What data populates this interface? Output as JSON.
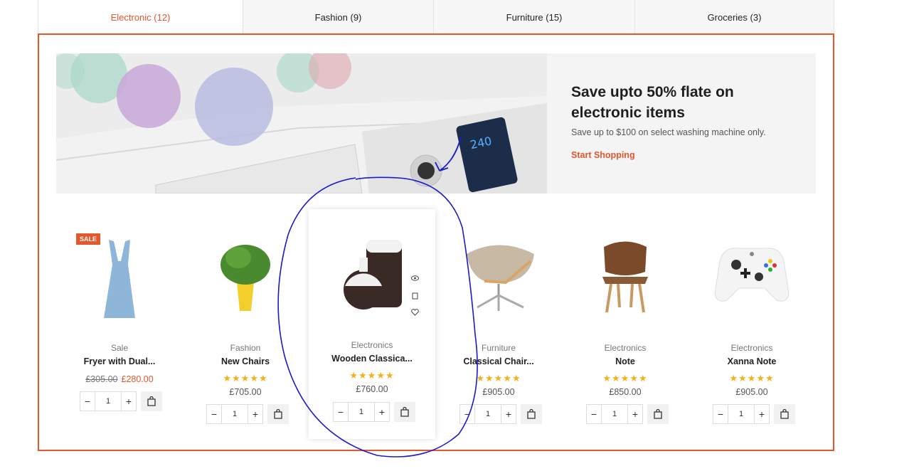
{
  "tabs": [
    {
      "label": "Electronic (12)"
    },
    {
      "label": "Fashion (9)"
    },
    {
      "label": "Furniture (15)"
    },
    {
      "label": "Groceries (3)"
    }
  ],
  "banner": {
    "title": "Save upto 50% flate on electronic items",
    "subtitle": "Save up to $100 on select washing machine only.",
    "cta": "Start Shopping"
  },
  "products": [
    {
      "badge": "SALE",
      "category": "Sale",
      "name": "Fryer with Dual...",
      "old_price": "£305.00",
      "price": "£280.00",
      "qty": "1",
      "rating": 0
    },
    {
      "category": "Fashion",
      "name": "New Chairs",
      "price": "£705.00",
      "qty": "1",
      "rating": 5
    },
    {
      "category": "Electronics",
      "name": "Wooden Classica...",
      "price": "£760.00",
      "qty": "1",
      "rating": 5
    },
    {
      "category": "Furniture",
      "name": "Classical Chair...",
      "price": "£905.00",
      "qty": "1",
      "rating": 5
    },
    {
      "category": "Electronics",
      "name": "Note",
      "price": "£850.00",
      "qty": "1",
      "rating": 5
    },
    {
      "category": "Electronics",
      "name": "Xanna Note",
      "price": "£905.00",
      "qty": "1",
      "rating": 5
    }
  ],
  "qty_controls": {
    "minus": "−",
    "plus": "+"
  },
  "stars": "★★★★★",
  "colors": {
    "accent": "#e2572b",
    "star": "#f5b11a",
    "annotation": "#1a1acc"
  }
}
